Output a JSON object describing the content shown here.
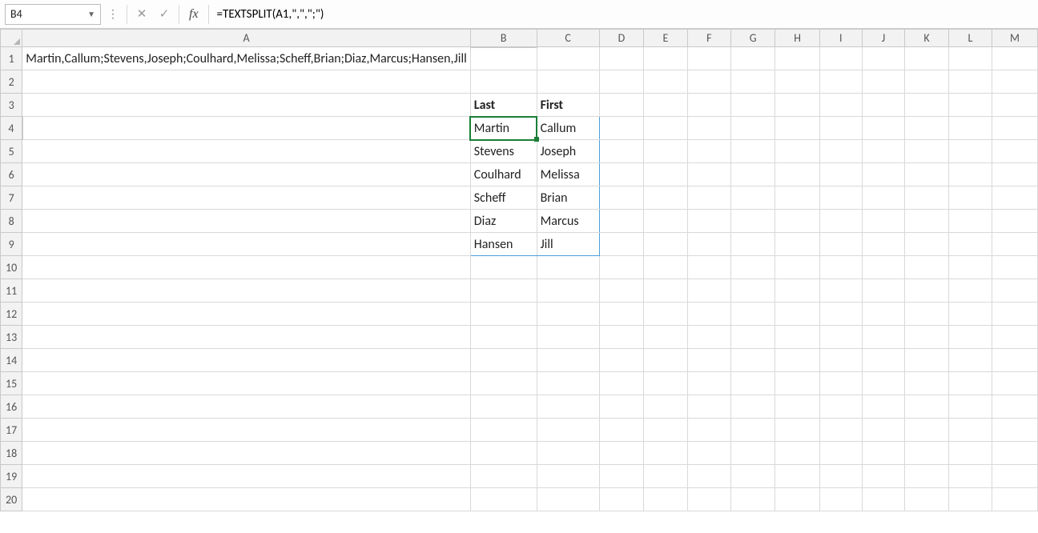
{
  "nameBox": {
    "value": "B4"
  },
  "formulaBar": {
    "cancel_icon": "✕",
    "enter_icon": "✓",
    "fx_label": "fx",
    "formula": "=TEXTSPLIT(A1,\",\",\";\")"
  },
  "columns": [
    "A",
    "B",
    "C",
    "D",
    "E",
    "F",
    "G",
    "H",
    "I",
    "J",
    "K",
    "L",
    "M"
  ],
  "rowCount": 20,
  "activeCell": {
    "col": 1,
    "row": 3
  },
  "spill": {
    "colStart": 1,
    "colEnd": 2,
    "rowStart": 3,
    "rowEnd": 8
  },
  "cells": {
    "A1": "Martin,Callum;Stevens,Joseph;Coulhard,Melissa;Scheff,Brian;Diaz,Marcus;Hansen,Jill",
    "B3": "Last",
    "C3": "First",
    "B4": "Martin",
    "C4": "Callum",
    "B5": "Stevens",
    "C5": "Joseph",
    "B6": "Coulhard",
    "C6": "Melissa",
    "B7": "Scheff",
    "C7": "Brian",
    "B8": "Diaz",
    "C8": "Marcus",
    "B9": "Hansen",
    "C9": "Jill"
  },
  "boldCells": [
    "B3",
    "C3"
  ]
}
